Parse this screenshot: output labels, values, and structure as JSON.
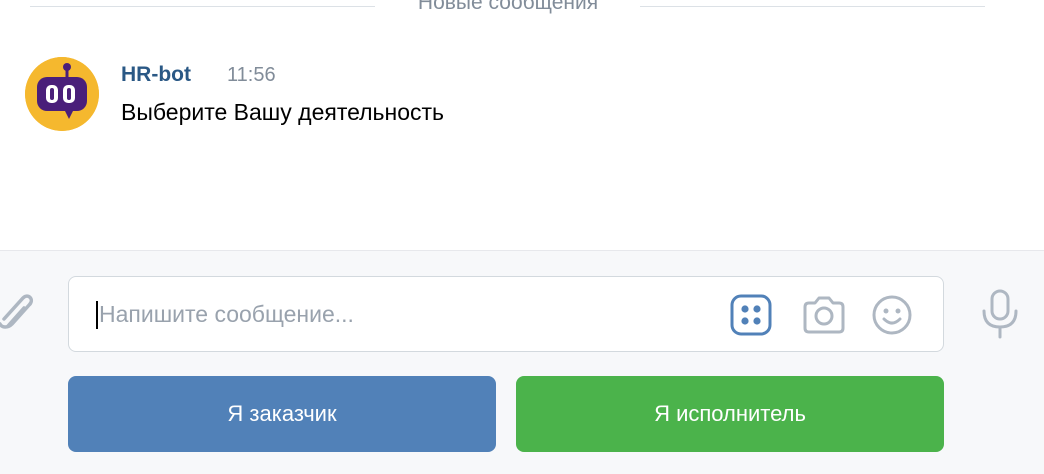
{
  "divider": {
    "label": "Новые сообщения"
  },
  "message": {
    "author": "HR-bot",
    "time": "11:56",
    "text": "Выберите Вашу деятельность"
  },
  "composer": {
    "placeholder": "Напишите сообщение..."
  },
  "keyboard_buttons": [
    {
      "label": "Я заказчик",
      "color": "#5181b8"
    },
    {
      "label": "Я исполнитель",
      "color": "#4bb34b"
    }
  ],
  "icons": {
    "attach": "paperclip-icon",
    "keyboard": "bot-keyboard-icon",
    "camera": "camera-icon",
    "emoji": "smile-icon",
    "mic": "microphone-icon"
  },
  "colors": {
    "author": "#2a5885",
    "accent_blue": "#5181b8",
    "accent_green": "#4bb34b",
    "avatar_bg": "#f5b82e",
    "avatar_face": "#4a1f7a"
  }
}
